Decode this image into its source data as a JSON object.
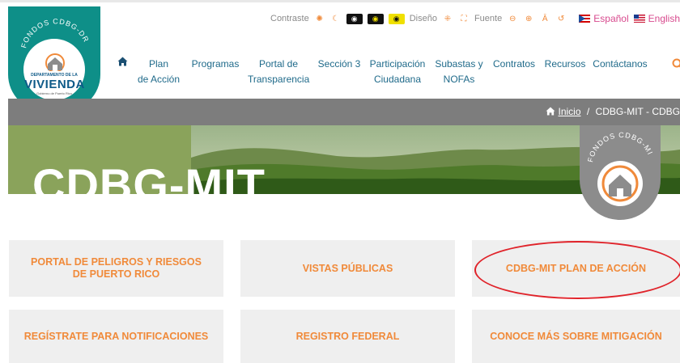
{
  "utility_bar": {
    "contrast_label": "Contraste",
    "design_label": "Diseño",
    "font_label": "Fuente",
    "lang_es": "Español",
    "lang_en": "English"
  },
  "logo": {
    "top_text": "FONDOS CDBG-DR",
    "dept_text": "DEPARTAMENTO DE LA",
    "name": "VIVIENDA",
    "gov_text": "Gobierno de Puerto Rico"
  },
  "nav": {
    "items": [
      {
        "line1": "Plan",
        "line2": "de Acción"
      },
      {
        "line1": "Programas",
        "line2": ""
      },
      {
        "line1": "Portal de",
        "line2": "Transparencia"
      },
      {
        "line1": "Sección 3",
        "line2": ""
      },
      {
        "line1": "Participación",
        "line2": "Ciudadana"
      },
      {
        "line1": "Subastas y",
        "line2": "NOFAs"
      },
      {
        "line1": "Contratos",
        "line2": ""
      },
      {
        "line1": "Recursos",
        "line2": ""
      },
      {
        "line1": "Contáctanos",
        "line2": ""
      }
    ]
  },
  "breadcrumb": {
    "home": "Inicio",
    "separator": "/",
    "current": "CDBG-MIT - CDBG"
  },
  "hero": {
    "title": "CDBG-MIT",
    "badge_text": "FONDOS CDBG-MIT"
  },
  "cards": [
    {
      "label": "PORTAL DE PELIGROS Y RIESGOS DE PUERTO RICO"
    },
    {
      "label": "VISTAS PÚBLICAS"
    },
    {
      "label": "CDBG-MIT PLAN DE ACCIÓN"
    },
    {
      "label": "REGÍSTRATE PARA NOTIFICACIONES"
    },
    {
      "label": "REGISTRO FEDERAL"
    },
    {
      "label": "CONOCE MÁS SOBRE MITIGACIÓN"
    }
  ],
  "colors": {
    "accent_orange": "#f08a3a",
    "teal": "#0e8f88",
    "highlight_red": "#e0232a",
    "nav_blue": "#1f6a8a"
  }
}
